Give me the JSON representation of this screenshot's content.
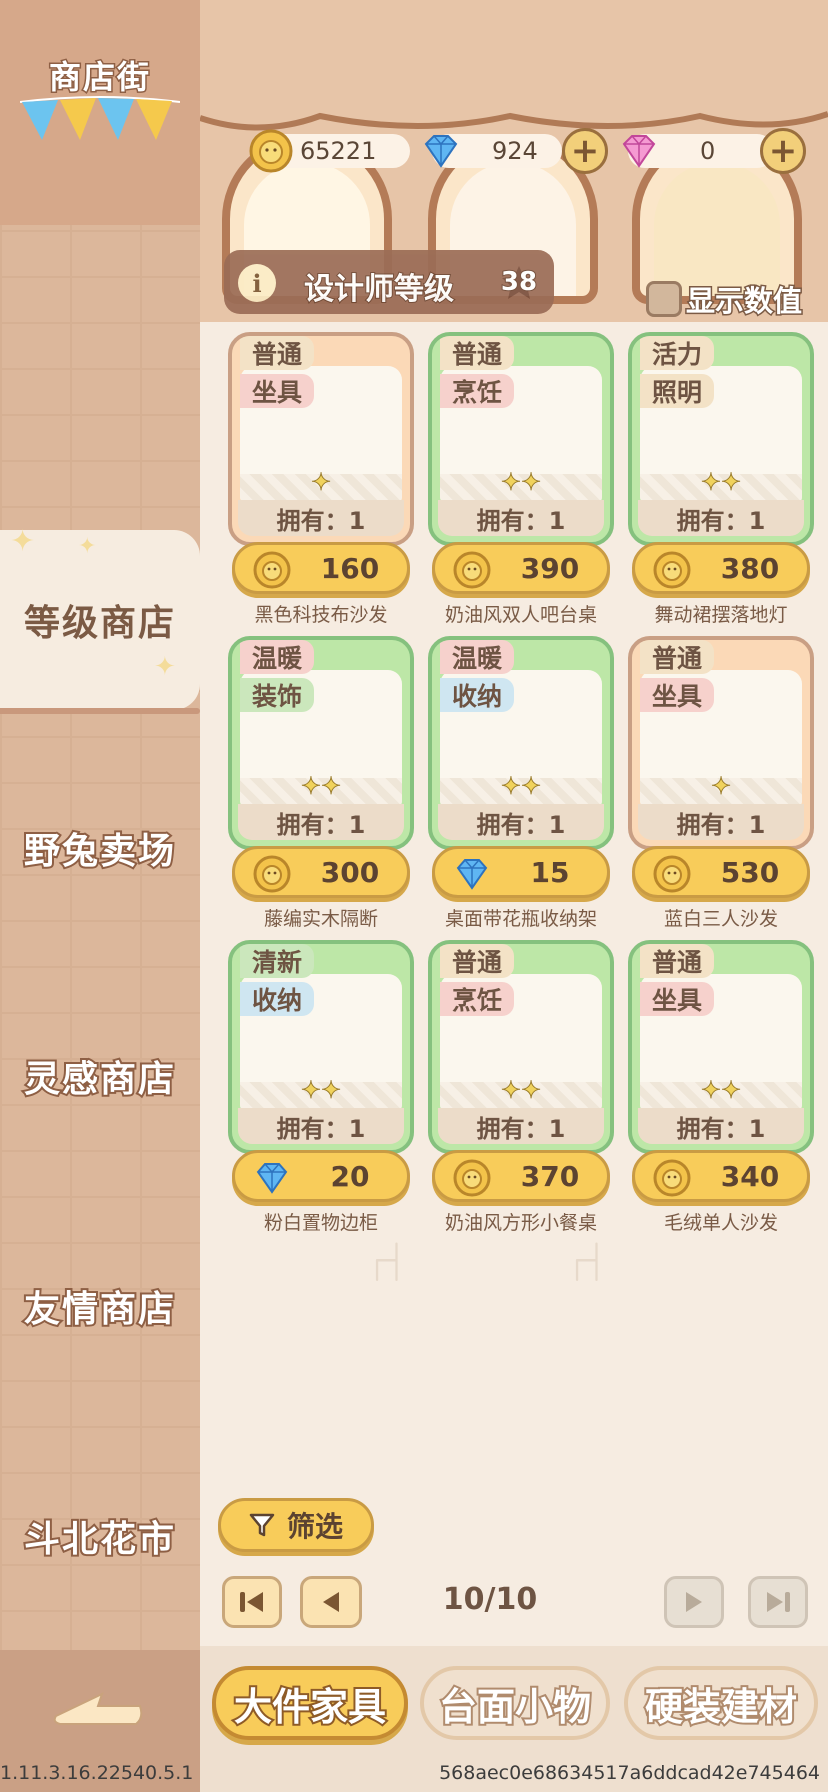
{
  "sidebar": {
    "title": "商店街",
    "items": [
      {
        "label": "等级商店",
        "active": true
      },
      {
        "label": "野兔卖场"
      },
      {
        "label": "灵感商店"
      },
      {
        "label": "友情商店"
      },
      {
        "label": "斗北花市"
      }
    ]
  },
  "currencies": {
    "coins": "65221",
    "diamonds": "924",
    "gems": "0"
  },
  "designer": {
    "label": "设计师等级",
    "level": "38",
    "info_icon": "i"
  },
  "show_values": {
    "label": "显示数值"
  },
  "products": [
    {
      "tags": [
        "普通",
        "坐具"
      ],
      "owned": "拥有：1",
      "currency": "coin",
      "price": "160",
      "name": "黑色科技布沙发",
      "stars": "✦"
    },
    {
      "tags": [
        "普通",
        "烹饪"
      ],
      "owned": "拥有：1",
      "currency": "coin",
      "price": "390",
      "name": "奶油风双人吧台桌",
      "stars": "✦✦"
    },
    {
      "tags": [
        "活力",
        "照明"
      ],
      "owned": "拥有：1",
      "currency": "coin",
      "price": "380",
      "name": "舞动裙摆落地灯",
      "stars": "✦✦"
    },
    {
      "tags": [
        "温暖",
        "装饰"
      ],
      "owned": "拥有：1",
      "currency": "coin",
      "price": "300",
      "name": "藤编实木隔断",
      "stars": "✦✦"
    },
    {
      "tags": [
        "温暖",
        "收纳"
      ],
      "owned": "拥有：1",
      "currency": "diamond",
      "price": "15",
      "name": "桌面带花瓶收纳架",
      "stars": "✦✦"
    },
    {
      "tags": [
        "普通",
        "坐具"
      ],
      "owned": "拥有：1",
      "currency": "coin",
      "price": "530",
      "name": "蓝白三人沙发",
      "stars": "✦"
    },
    {
      "tags": [
        "清新",
        "收纳"
      ],
      "owned": "拥有：1",
      "currency": "diamond",
      "price": "20",
      "name": "粉白置物边柜",
      "stars": "✦✦"
    },
    {
      "tags": [
        "普通",
        "烹饪"
      ],
      "owned": "拥有：1",
      "currency": "coin",
      "price": "370",
      "name": "奶油风方形小餐桌",
      "stars": "✦✦"
    },
    {
      "tags": [
        "普通",
        "坐具"
      ],
      "owned": "拥有：1",
      "currency": "coin",
      "price": "340",
      "name": "毛绒单人沙发",
      "stars": "✦✦"
    }
  ],
  "filter": {
    "label": "筛选"
  },
  "pagination": {
    "page": "10/10"
  },
  "category_tabs": [
    {
      "label": "大件家具",
      "active": true
    },
    {
      "label": "台面小物"
    },
    {
      "label": "硬装建材"
    }
  ],
  "footer": {
    "version": "1.11.3.16.22540.5.1",
    "hash": "568aec0e68634517a6ddcad42e745464"
  },
  "colors": {
    "accent_yellow": "#f8cc5a",
    "card_green": "#bde7a7",
    "card_orange": "#fbd9b7",
    "sidebar_brown": "#dcb79b"
  }
}
